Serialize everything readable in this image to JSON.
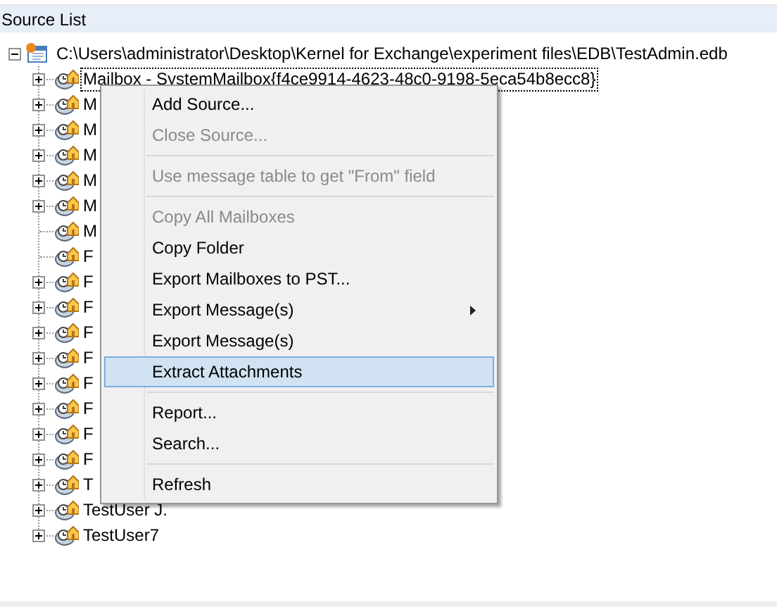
{
  "panel": {
    "title": "Source List"
  },
  "tree": {
    "label": "C:\\Users\\administrator\\Desktop\\Kernel for Exchange\\experiment files\\EDB\\TestAdmin.edb",
    "expanded": true,
    "children": [
      {
        "label": "Mailbox - SystemMailbox{f4ce9914-4623-48c0-9198-5eca54b8ecc8}",
        "has_children": true,
        "selected": true
      },
      {
        "label": "M",
        "has_children": true,
        "selected": false
      },
      {
        "label": "M",
        "has_children": true,
        "selected": false
      },
      {
        "label": "M",
        "has_children": true,
        "selected": false
      },
      {
        "label": "M",
        "has_children": true,
        "selected": false
      },
      {
        "label": "M",
        "has_children": true,
        "selected": false
      },
      {
        "label": "M",
        "has_children": false,
        "selected": false
      },
      {
        "label": "F",
        "has_children": false,
        "selected": false
      },
      {
        "label": "F",
        "has_children": true,
        "selected": false
      },
      {
        "label": "F",
        "has_children": true,
        "selected": false
      },
      {
        "label": "F",
        "has_children": true,
        "selected": false
      },
      {
        "label": "F",
        "has_children": true,
        "selected": false
      },
      {
        "label": "F",
        "has_children": true,
        "selected": false
      },
      {
        "label": "F",
        "has_children": true,
        "selected": false
      },
      {
        "label": "F",
        "has_children": true,
        "selected": false
      },
      {
        "label": "F",
        "has_children": true,
        "selected": false
      },
      {
        "label": "T",
        "has_children": true,
        "selected": false
      },
      {
        "label": "TestUser J.",
        "has_children": true,
        "selected": false
      },
      {
        "label": "TestUser7",
        "has_children": true,
        "selected": false
      }
    ]
  },
  "context_menu": [
    {
      "kind": "item",
      "label": "Add Source...",
      "disabled": false,
      "selected": false
    },
    {
      "kind": "item",
      "label": "Close Source...",
      "disabled": true,
      "selected": false
    },
    {
      "kind": "separator"
    },
    {
      "kind": "item",
      "label": "Use message table to get \"From\" field",
      "disabled": true,
      "selected": false
    },
    {
      "kind": "separator"
    },
    {
      "kind": "item",
      "label": "Copy All Mailboxes",
      "disabled": true,
      "selected": false
    },
    {
      "kind": "item",
      "label": "Copy Folder",
      "disabled": false,
      "selected": false
    },
    {
      "kind": "item",
      "label": "Export Mailboxes to PST...",
      "disabled": false,
      "selected": false
    },
    {
      "kind": "submenu",
      "label": "Export Message(s)",
      "disabled": false,
      "selected": false
    },
    {
      "kind": "item",
      "label": "Export Message(s)",
      "disabled": false,
      "selected": false
    },
    {
      "kind": "item",
      "label": "Extract Attachments",
      "disabled": false,
      "selected": true
    },
    {
      "kind": "separator"
    },
    {
      "kind": "item",
      "label": "Report...",
      "disabled": false,
      "selected": false
    },
    {
      "kind": "item",
      "label": "Search...",
      "disabled": false,
      "selected": false
    },
    {
      "kind": "separator"
    },
    {
      "kind": "item",
      "label": "Refresh",
      "disabled": false,
      "selected": false
    }
  ]
}
